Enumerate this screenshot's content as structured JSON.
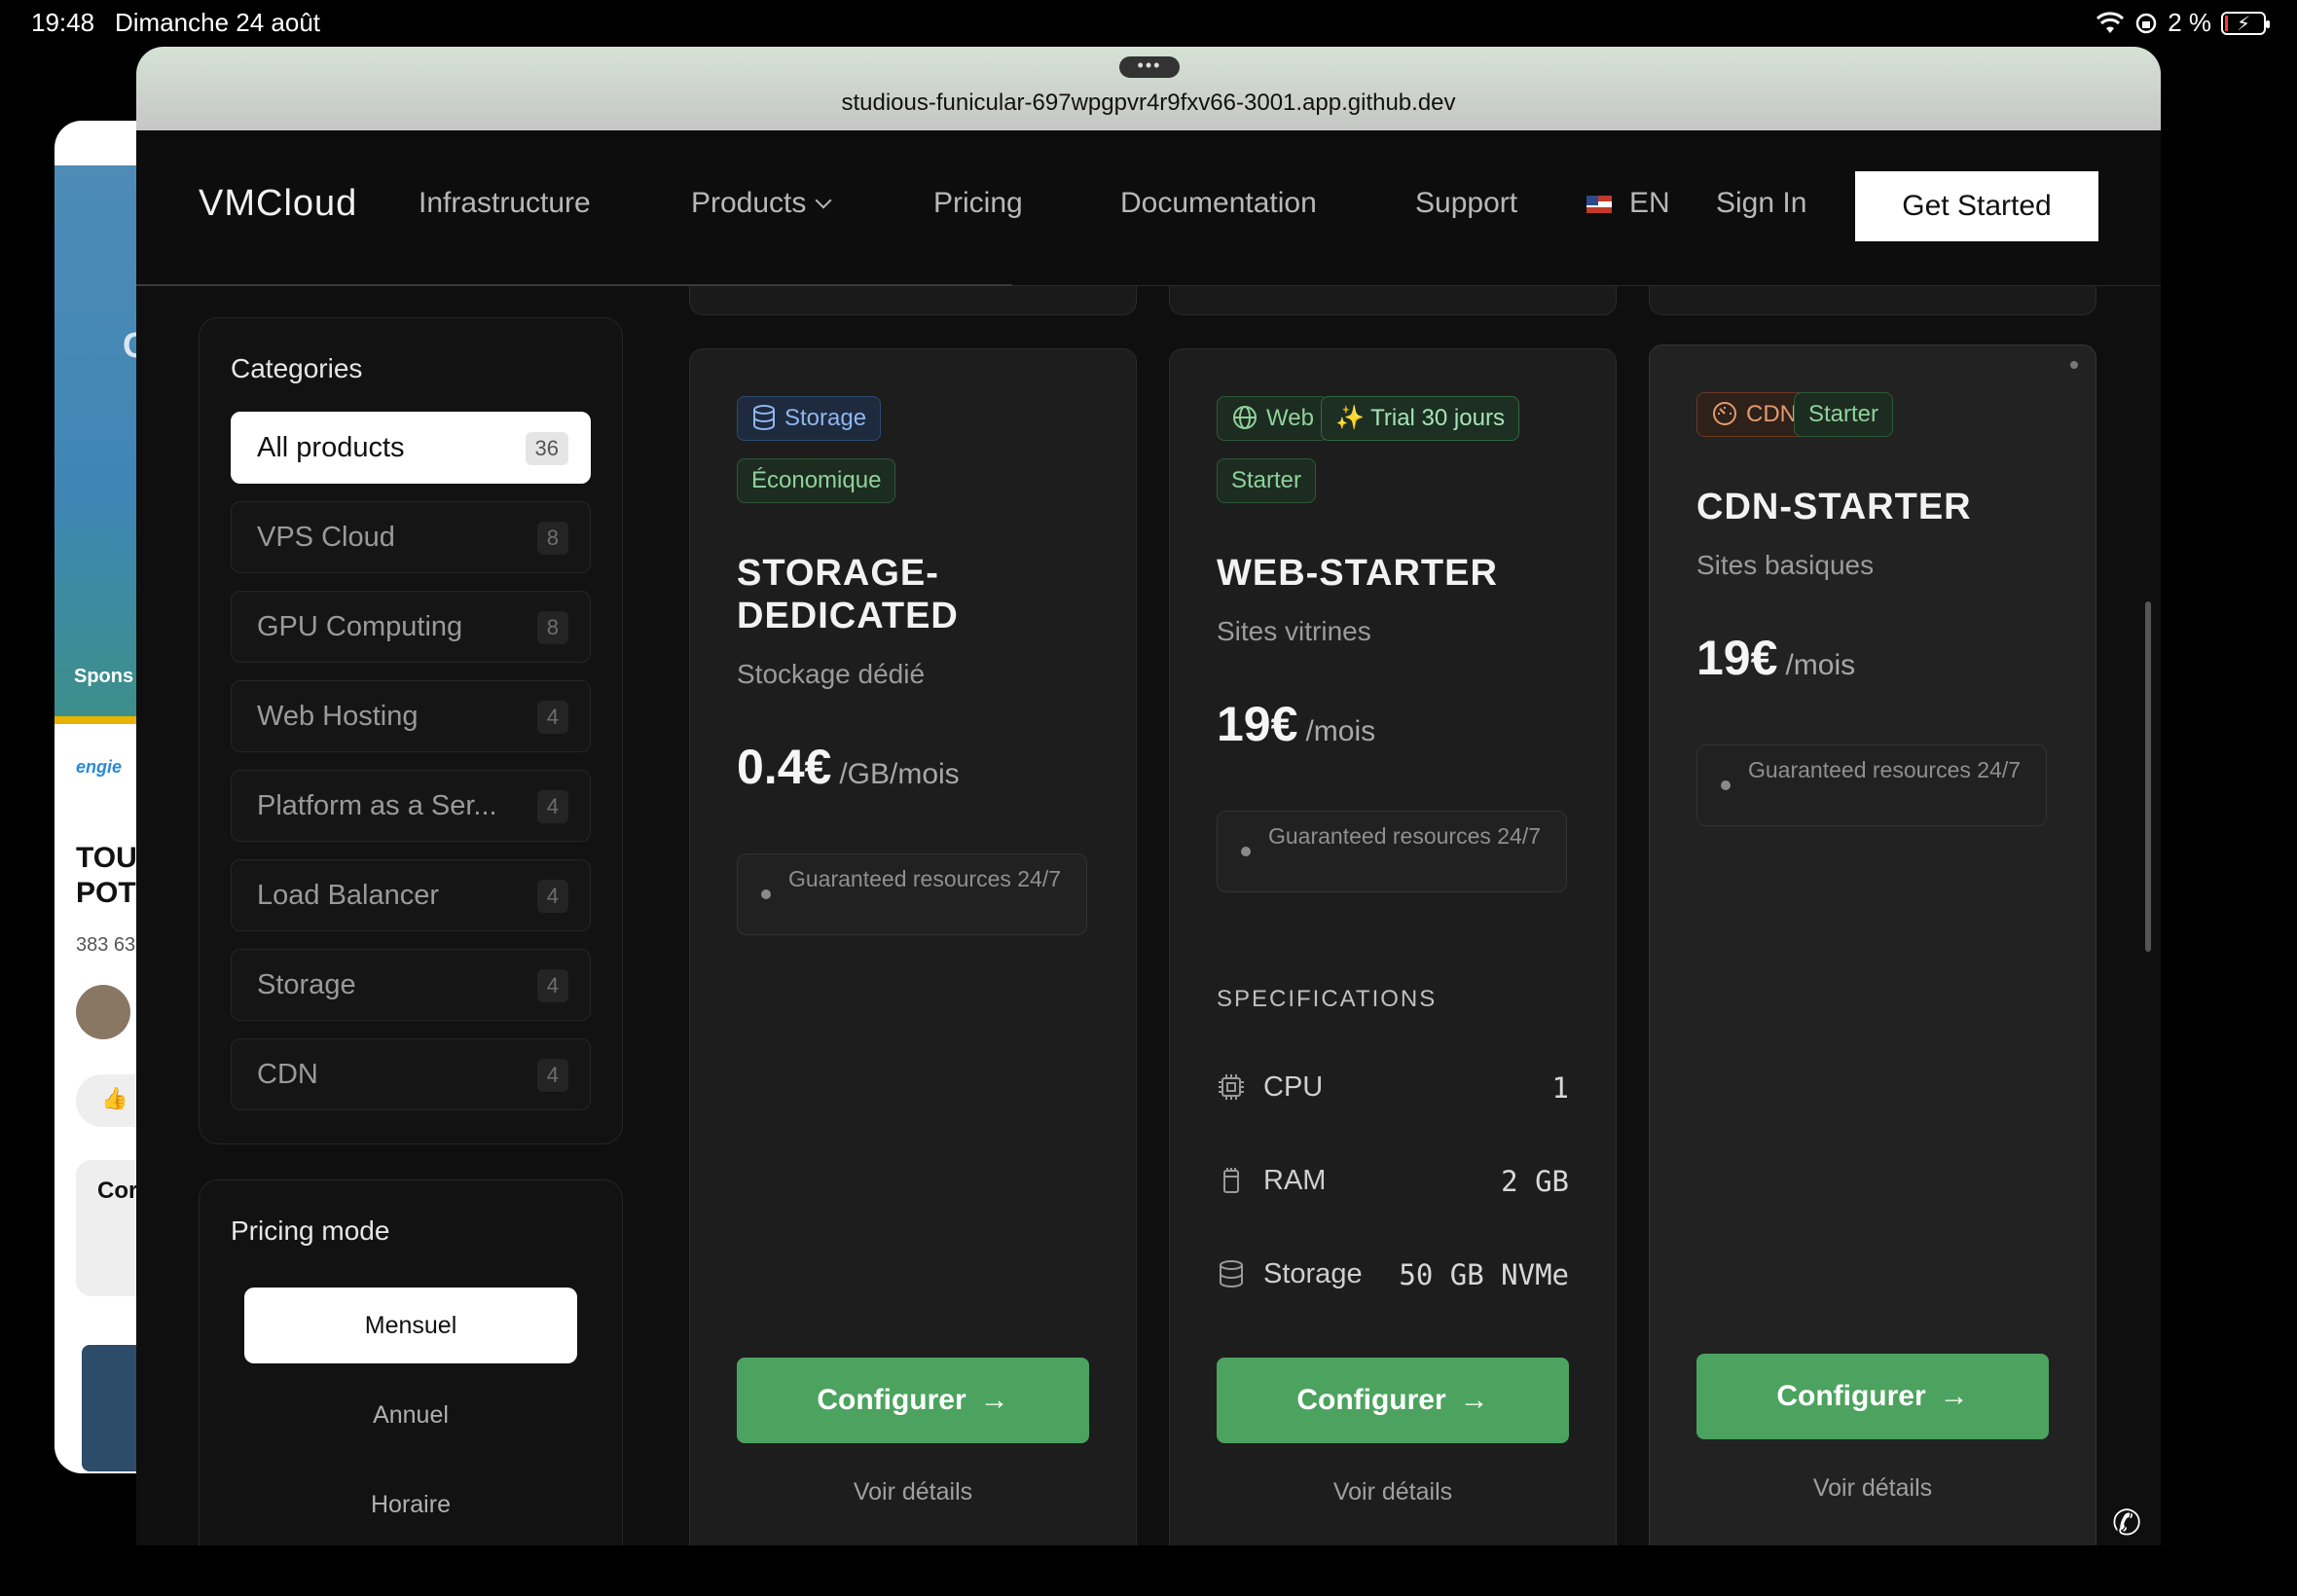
{
  "status": {
    "time": "19:48",
    "date": "Dimanche 24 août",
    "battery": "2 %"
  },
  "background_app": {
    "sponsor_label": "Spons",
    "brand": "engie",
    "headline": "TOU POT",
    "views": "383 63",
    "comment_label": "Cor"
  },
  "browser": {
    "url": "studious-funicular-697wpgpvr4r9fxv66-3001.app.github.dev"
  },
  "nav": {
    "brand": "VMCloud",
    "items": [
      "Infrastructure",
      "Products",
      "Pricing",
      "Documentation",
      "Support"
    ],
    "language": "EN",
    "sign_in": "Sign In",
    "cta": "Get Started"
  },
  "sidebar": {
    "categories_title": "Categories",
    "categories": [
      {
        "label": "All products",
        "count": "36",
        "active": true
      },
      {
        "label": "VPS Cloud",
        "count": "8"
      },
      {
        "label": "GPU Computing",
        "count": "8"
      },
      {
        "label": "Web Hosting",
        "count": "4"
      },
      {
        "label": "Platform as a Ser...",
        "count": "4"
      },
      {
        "label": "Load Balancer",
        "count": "4"
      },
      {
        "label": "Storage",
        "count": "4"
      },
      {
        "label": "CDN",
        "count": "4"
      }
    ],
    "pricing_title": "Pricing mode",
    "pricing_modes": [
      {
        "label": "Mensuel",
        "active": true
      },
      {
        "label": "Annuel"
      },
      {
        "label": "Horaire"
      }
    ]
  },
  "cards": [
    {
      "category_badge": "Storage",
      "tags": [
        "Économique"
      ],
      "title": "STORAGE-DEDICATED",
      "subtitle": "Stockage dédié",
      "price": "0.4€",
      "period": "/GB/mois",
      "guarantee": "Guaranteed resources 24/7",
      "cta": "Configurer",
      "details": "Voir détails"
    },
    {
      "category_badge": "Web",
      "trial_badge": "✨ Trial 30 jours",
      "tags": [
        "Starter"
      ],
      "title": "WEB-STARTER",
      "subtitle": "Sites vitrines",
      "price": "19€",
      "period": "/mois",
      "guarantee": "Guaranteed resources 24/7",
      "specs_title": "SPECIFICATIONS",
      "specs": [
        {
          "label": "CPU",
          "value": "1",
          "icon": "cpu-icon"
        },
        {
          "label": "RAM",
          "value": "2 GB",
          "icon": "ram-icon"
        },
        {
          "label": "Storage",
          "value": "50 GB NVMe",
          "icon": "database-icon"
        }
      ],
      "cta": "Configurer",
      "details": "Voir détails"
    },
    {
      "category_badge": "CDN",
      "tags": [
        "Starter"
      ],
      "title": "CDN-STARTER",
      "subtitle": "Sites basiques",
      "price": "19€",
      "period": "/mois",
      "guarantee": "Guaranteed resources 24/7",
      "cta": "Configurer",
      "details": "Voir détails"
    }
  ],
  "colors": {
    "accent_green": "#4ca35f",
    "background": "#0f0f0f",
    "card": "#1d1d1d"
  }
}
